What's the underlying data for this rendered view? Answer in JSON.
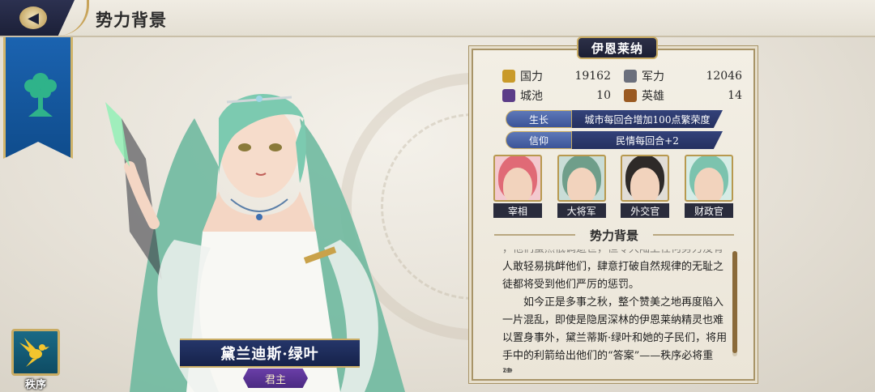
{
  "header": {
    "title": "势力背景"
  },
  "sidebar": {
    "banner_icon": "tree-emblem-icon"
  },
  "order": {
    "label": "秩序",
    "icon": "bird-emblem-icon"
  },
  "character": {
    "name": "黛兰迪斯·绿叶",
    "title": "君主"
  },
  "faction": {
    "name": "伊恩莱纳",
    "stats": [
      {
        "label": "国力",
        "value": "19162",
        "icon": "power-icon",
        "color": "#c99a2a"
      },
      {
        "label": "军力",
        "value": "12046",
        "icon": "military-icon",
        "color": "#6b6f7c"
      },
      {
        "label": "城池",
        "value": "10",
        "icon": "city-icon",
        "color": "#5b3c88"
      },
      {
        "label": "英雄",
        "value": "14",
        "icon": "hero-icon",
        "color": "#9a5a22"
      }
    ],
    "traits": [
      {
        "key": "生长",
        "value": "城市每回合增加100点繁荣度"
      },
      {
        "key": "信仰",
        "value": "民情每回合+2"
      }
    ],
    "officers": [
      {
        "label": "宰相",
        "hair": "#e06a76",
        "bg": "#f3c9cf"
      },
      {
        "label": "大将军",
        "hair": "#6f9e8a",
        "bg": "#c9ddd7"
      },
      {
        "label": "外交官",
        "hair": "#2e2a28",
        "bg": "#e1ddd6"
      },
      {
        "label": "财政官",
        "hair": "#7cc3ae",
        "bg": "#d6ece6"
      }
    ],
    "section_title": "势力背景",
    "story": {
      "lead": "，他们虽然低调避世，但令大陆上任何势力没有",
      "p1": "人敢轻易挑衅他们，肆意打破自然规律的无耻之徒都将受到他们严厉的惩罚。",
      "p2": "如今正是多事之秋，整个赞美之地再度陷入一片混乱，即使是隐居深林的伊恩莱纳精灵也难以置身事外，黛兰蒂斯·绿叶和她的子民们，将用手中的利箭给出他们的“答案”——秩序必将重建。"
    }
  }
}
